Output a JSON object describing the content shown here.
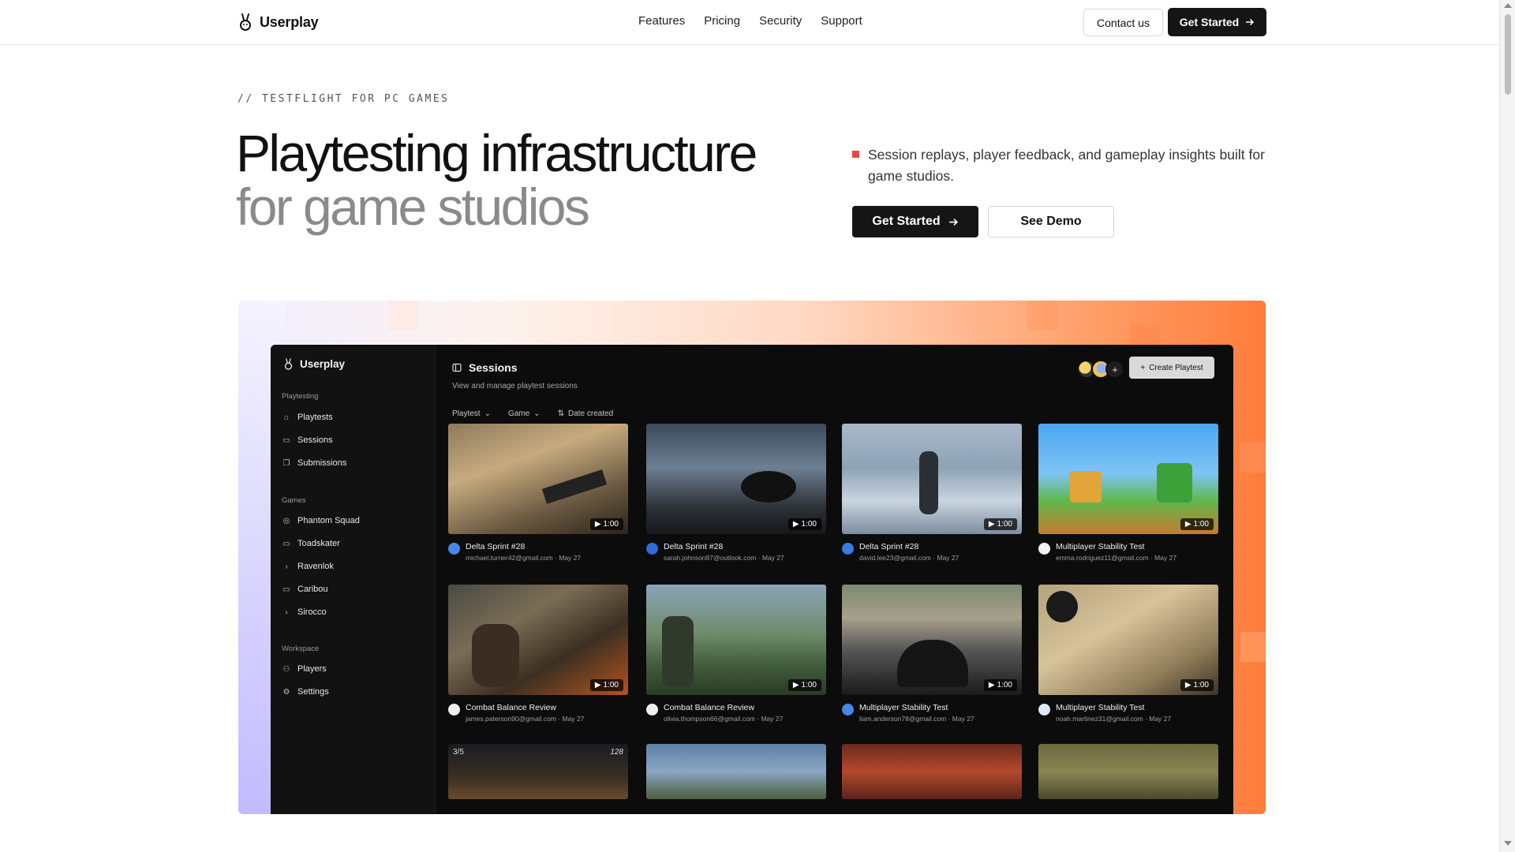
{
  "nav": {
    "brand": "Userplay",
    "links": [
      "Features",
      "Pricing",
      "Security",
      "Support"
    ],
    "contact_label": "Contact us",
    "cta_label": "Get Started"
  },
  "hero": {
    "eyebrow": "// TESTFLIGHT FOR PC GAMES",
    "title_line1": "Playtesting infrastructure",
    "title_line2": "for game studios",
    "description": "Session replays, player feedback, and gameplay insights built for game studios.",
    "primary_label": "Get Started",
    "secondary_label": "See Demo"
  },
  "app": {
    "brand": "Userplay",
    "sections": {
      "playtesting": "Playtesting",
      "games": "Games",
      "workspace": "Workspace"
    },
    "playtesting_items": [
      "Playtests",
      "Sessions",
      "Submissions"
    ],
    "game_items": [
      "Phantom Squad",
      "Toadskater",
      "Ravenlok",
      "Caribou",
      "Sirocco"
    ],
    "workspace_items": [
      "Players",
      "Settings"
    ],
    "page_title": "Sessions",
    "page_subtitle": "View and manage playtest sessions",
    "filters": [
      "Playtest",
      "Game",
      "Date created"
    ],
    "create_label": "Create Playtest",
    "sessions": [
      {
        "title": "Delta Sprint #28",
        "email": "michael.turner42@gmail.com",
        "date": "May 27",
        "duration": "1:00"
      },
      {
        "title": "Delta Sprint #28",
        "email": "sarah.johnson87@outlook.com",
        "date": "May 27",
        "duration": "1:00"
      },
      {
        "title": "Delta Sprint #28",
        "email": "david.lee23@gmail.com",
        "date": "May 27",
        "duration": "1:00"
      },
      {
        "title": "Multiplayer Stability Test",
        "email": "emma.rodriguez11@gmail.com",
        "date": "May 27",
        "duration": "1:00"
      },
      {
        "title": "Combat Balance Review",
        "email": "james.paterson90@gmail.com",
        "date": "May 27",
        "duration": "1:00"
      },
      {
        "title": "Combat Balance Review",
        "email": "olivia.thompson66@gmail.com",
        "date": "May 27",
        "duration": "1:00"
      },
      {
        "title": "Multiplayer Stability Test",
        "email": "liam.anderson78@gmail.com",
        "date": "May 27",
        "duration": "1:00"
      },
      {
        "title": "Multiplayer Stability Test",
        "email": "noah.martinez31@gmail.com",
        "date": "May 27",
        "duration": "1:00"
      }
    ],
    "partial_row_hud": {
      "left": "3/5",
      "right": "128"
    }
  },
  "colors": {
    "accent_red": "#e8484a",
    "dark_button": "#151515",
    "app_bg": "#0c0c0c",
    "gradient_orange": "#ff7c3a",
    "gradient_violet": "#b2aaff"
  },
  "icons": [
    "brand-logo-icon",
    "arrow-right-icon",
    "sidebar-toggle-icon",
    "gamepad-icon",
    "video-icon",
    "submissions-icon",
    "globe-icon",
    "window-icon",
    "terminal-icon",
    "users-icon",
    "gear-icon",
    "chevron-down-icon",
    "sort-icon",
    "plus-icon",
    "play-icon"
  ]
}
